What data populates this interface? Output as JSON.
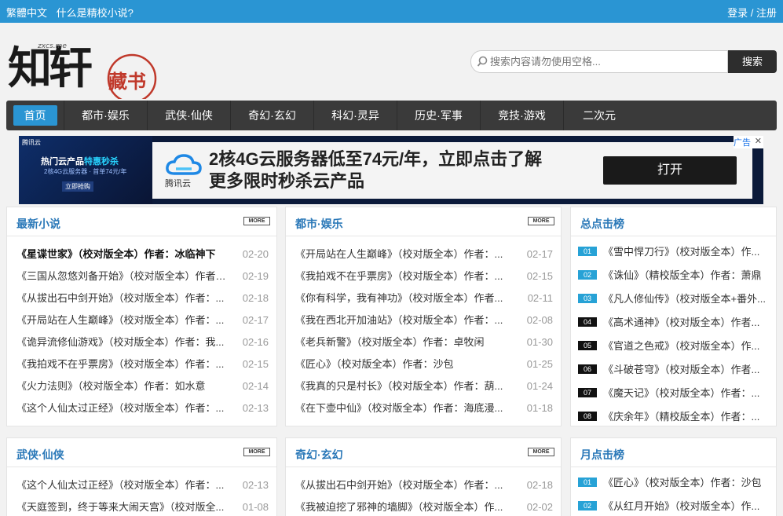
{
  "topbar": {
    "lang": "繁體中文",
    "about": "什么是精校小说?",
    "login": "登录",
    "sep": "/",
    "register": "注册"
  },
  "logo": {
    "main": "知轩",
    "seal": "藏书",
    "domain": "zxcs.me"
  },
  "search": {
    "placeholder": "搜索内容请勿使用空格...",
    "button": "搜索"
  },
  "nav": [
    "首页",
    "都市·娱乐",
    "武侠·仙侠",
    "奇幻·玄幻",
    "科幻·灵异",
    "历史·军事",
    "竞技·游戏",
    "二次元"
  ],
  "ad": {
    "left_brand": "腾讯云",
    "left_title_a": "热门云产品",
    "left_title_b": "特惠秒杀",
    "left_sub": "2核4G云服务器 · 首单74元/年",
    "left_btn": "立即抢购",
    "logo_name": "腾讯云",
    "line1": "2核4G云服务器低至74元/年，立即点击了解",
    "line2": "更多限时秒杀云产品",
    "button": "打开",
    "tag": "广告",
    "close": "✕"
  },
  "more_label": "MORE",
  "panels": [
    {
      "title": "最新小说",
      "items": [
        {
          "t": "《星谍世家》（校对版全本）作者：冰临神下",
          "d": "02-20",
          "bold": true
        },
        {
          "t": "《三国从忽悠刘备开始》（校对版全本）作者：...",
          "d": "02-19"
        },
        {
          "t": "《从拔出石中剑开始》（校对版全本）作者：...",
          "d": "02-18"
        },
        {
          "t": "《开局站在人生巅峰》（校对版全本）作者：...",
          "d": "02-17"
        },
        {
          "t": "《诡异流修仙游戏》（校对版全本）作者：我...",
          "d": "02-16"
        },
        {
          "t": "《我拍戏不在乎票房》（校对版全本）作者：...",
          "d": "02-15"
        },
        {
          "t": "《火力法则》（校对版全本）作者：如水意",
          "d": "02-14"
        },
        {
          "t": "《这个人仙太过正经》（校对版全本）作者：...",
          "d": "02-13"
        }
      ]
    },
    {
      "title": "都市·娱乐",
      "items": [
        {
          "t": "《开局站在人生巅峰》（校对版全本）作者：...",
          "d": "02-17"
        },
        {
          "t": "《我拍戏不在乎票房》（校对版全本）作者：...",
          "d": "02-15"
        },
        {
          "t": "《你有科学，我有神功》（校对版全本）作者...",
          "d": "02-11"
        },
        {
          "t": "《我在西北开加油站》（校对版全本）作者：...",
          "d": "02-08"
        },
        {
          "t": "《老兵新警》（校对版全本）作者：卓牧闲",
          "d": "01-30"
        },
        {
          "t": "《匠心》（校对版全本）作者：沙包",
          "d": "01-25"
        },
        {
          "t": "《我真的只是村长》（校对版全本）作者：葫...",
          "d": "01-24"
        },
        {
          "t": "《在下壶中仙》（校对版全本）作者：海底漫...",
          "d": "01-18"
        }
      ]
    },
    {
      "title": "武侠·仙侠",
      "items": [
        {
          "t": "《这个人仙太过正经》（校对版全本）作者：...",
          "d": "02-13"
        },
        {
          "t": "《天庭签到，终于等来大闹天宫》（校对版全...",
          "d": "01-08"
        }
      ]
    },
    {
      "title": "奇幻·玄幻",
      "items": [
        {
          "t": "《从拔出石中剑开始》（校对版全本）作者：...",
          "d": "02-18"
        },
        {
          "t": "《我被迫挖了邪神的墙脚》（校对版全本）作...",
          "d": "02-02"
        }
      ]
    }
  ],
  "rank_total": {
    "title": "总点击榜",
    "items": [
      {
        "n": "01",
        "t": "《雪中悍刀行》（校对版全本）作..."
      },
      {
        "n": "02",
        "t": "《诛仙》（精校版全本）作者：萧鼎"
      },
      {
        "n": "03",
        "t": "《凡人修仙传》（校对版全本+番外..."
      },
      {
        "n": "04",
        "t": "《高术通神》（校对版全本）作者..."
      },
      {
        "n": "05",
        "t": "《官道之色戒》（校对版全本）作..."
      },
      {
        "n": "06",
        "t": "《斗破苍穹》（校对版全本）作者..."
      },
      {
        "n": "07",
        "t": "《魔天记》（校对版全本）作者：..."
      },
      {
        "n": "08",
        "t": "《庆余年》（精校版全本）作者：..."
      }
    ]
  },
  "rank_month": {
    "title": "月点击榜",
    "items": [
      {
        "n": "01",
        "t": "《匠心》（校对版全本）作者：沙包"
      },
      {
        "n": "02",
        "t": "《从红月开始》（校对版全本）作..."
      }
    ]
  }
}
